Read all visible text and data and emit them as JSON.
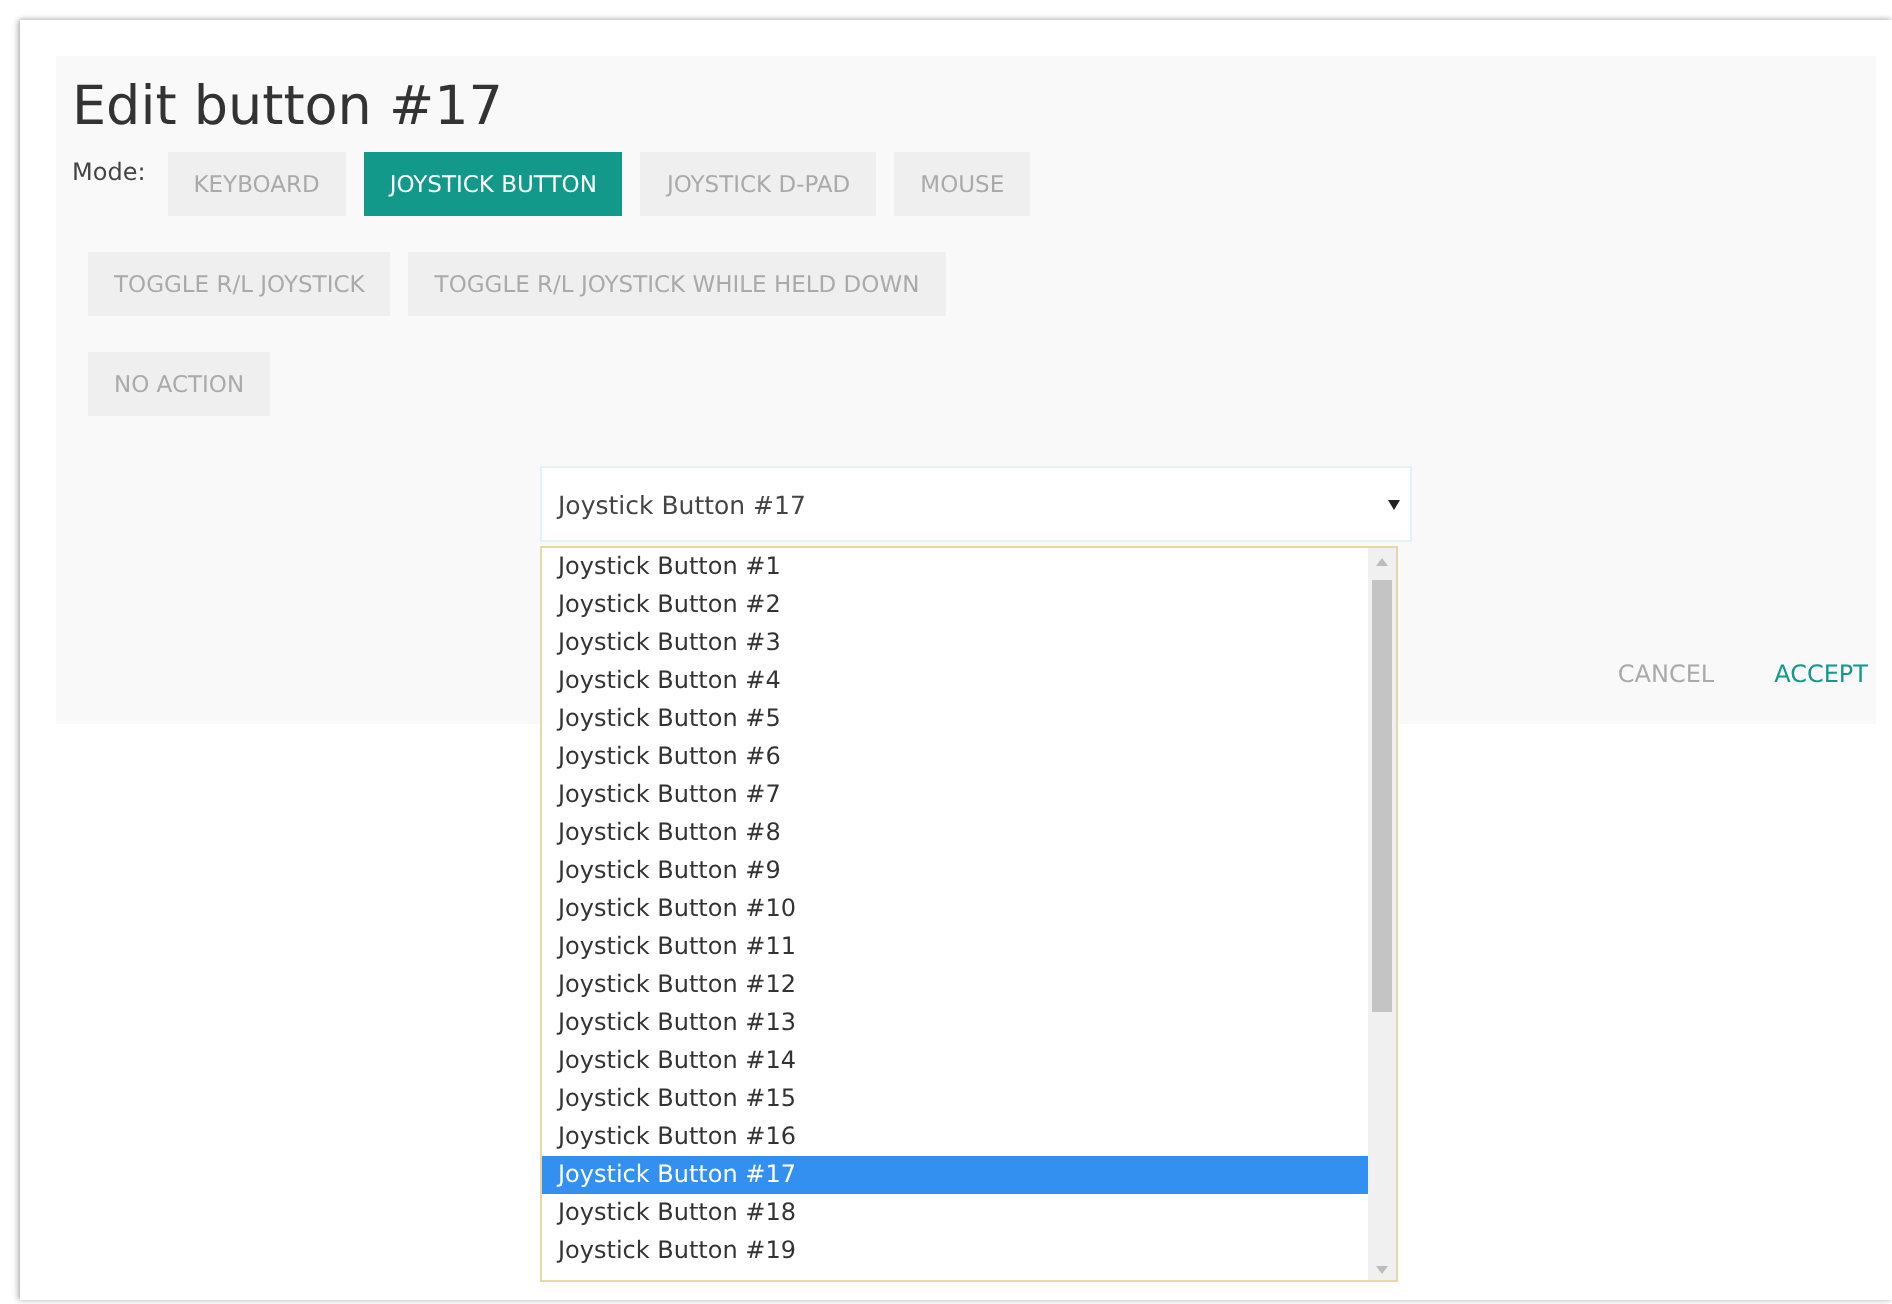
{
  "dialog": {
    "title": "Edit button #17",
    "mode_label": "Mode:",
    "modes": [
      {
        "label": "KEYBOARD",
        "selected": false
      },
      {
        "label": "JOYSTICK BUTTON",
        "selected": true
      },
      {
        "label": "JOYSTICK D-PAD",
        "selected": false
      },
      {
        "label": "MOUSE",
        "selected": false
      },
      {
        "label": "TOGGLE R/L JOYSTICK",
        "selected": false
      },
      {
        "label": "TOGGLE R/L JOYSTICK WHILE HELD DOWN",
        "selected": false
      },
      {
        "label": "NO ACTION",
        "selected": false
      }
    ],
    "select": {
      "value": "Joystick Button #17"
    },
    "actions": [
      {
        "label": "CANCEL",
        "kind": "secondary"
      },
      {
        "label": "ACCEPT",
        "kind": "primary"
      }
    ]
  },
  "dropdown": {
    "options": [
      {
        "label": "Joystick Button #1",
        "selected": false
      },
      {
        "label": "Joystick Button #2",
        "selected": false
      },
      {
        "label": "Joystick Button #3",
        "selected": false
      },
      {
        "label": "Joystick Button #4",
        "selected": false
      },
      {
        "label": "Joystick Button #5",
        "selected": false
      },
      {
        "label": "Joystick Button #6",
        "selected": false
      },
      {
        "label": "Joystick Button #7",
        "selected": false
      },
      {
        "label": "Joystick Button #8",
        "selected": false
      },
      {
        "label": "Joystick Button #9",
        "selected": false
      },
      {
        "label": "Joystick Button #10",
        "selected": false
      },
      {
        "label": "Joystick Button #11",
        "selected": false
      },
      {
        "label": "Joystick Button #12",
        "selected": false
      },
      {
        "label": "Joystick Button #13",
        "selected": false
      },
      {
        "label": "Joystick Button #14",
        "selected": false
      },
      {
        "label": "Joystick Button #15",
        "selected": false
      },
      {
        "label": "Joystick Button #16",
        "selected": false
      },
      {
        "label": "Joystick Button #17",
        "selected": true
      },
      {
        "label": "Joystick Button #18",
        "selected": false
      },
      {
        "label": "Joystick Button #19",
        "selected": false
      }
    ]
  }
}
